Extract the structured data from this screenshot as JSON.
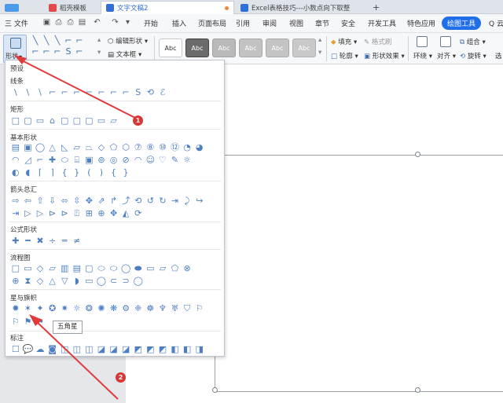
{
  "tabs": [
    {
      "label": "稻壳模板",
      "color": "#e34b4b"
    },
    {
      "label": "文字文稿2",
      "color": "#2f6fd6",
      "active": true
    },
    {
      "label": "Excel表格技巧---小数点向下取整",
      "color": "#2f6fd6"
    }
  ],
  "new_tab": "+",
  "menu": {
    "file": "三 文件",
    "items": [
      "开始",
      "插入",
      "页面布局",
      "引用",
      "审阅",
      "视图",
      "章节",
      "安全",
      "开发工具",
      "特色应用"
    ],
    "active_tool": "绘图工具",
    "search_fragment": "Q 云"
  },
  "ribbon": {
    "shape_label": "形状",
    "edit_shape": "编辑形状",
    "text_box": "文本框",
    "style_abc": [
      "Abc",
      "Abc",
      "Abc",
      "Abc",
      "Abc",
      "Abc"
    ],
    "fill": "填充",
    "format_brush": "格式刷",
    "outline": "轮廓",
    "shape_effects": "形状效果",
    "wrap": "环绕",
    "align": "对齐",
    "group": "组合",
    "rotate": "旋转",
    "select": "选"
  },
  "panel": {
    "preset": "预设",
    "sections": [
      {
        "title": "线条",
        "rows": [
          [
            "\\",
            "\\",
            "\\",
            "⌐",
            "⌐",
            "⌐",
            "⌐",
            "⌐",
            "⌐",
            "⌐",
            "S",
            "⟲",
            "ℰ"
          ]
        ]
      },
      {
        "title": "矩形",
        "rows": [
          [
            "□",
            "▢",
            "▭",
            "⌂",
            "▢",
            "▢",
            "▢",
            "▭",
            "▱"
          ]
        ]
      },
      {
        "title": "基本形状",
        "rows": [
          [
            "▤",
            "▣",
            "◯",
            "△",
            "◺",
            "▱",
            "⏢",
            "◇",
            "⬠",
            "⬡",
            "⑦",
            "⑧",
            "⑩",
            "⑫",
            "◔",
            "◕"
          ],
          [
            "◠",
            "◿",
            "⌐",
            "✚",
            "⬭",
            "⌸",
            "▣",
            "⊚",
            "◎",
            "⊘",
            "◠",
            "☺",
            "♡",
            "✎",
            "☼"
          ],
          [
            "◐",
            "◖",
            "⌈",
            "⌉",
            "{",
            "}",
            "(",
            ")",
            "{",
            "}"
          ]
        ]
      },
      {
        "title": "箭头总汇",
        "rows": [
          [
            "⇨",
            "⇦",
            "⇧",
            "⇩",
            "⬄",
            "⇳",
            "✥",
            "⇗",
            "↱",
            "⤴",
            "⟲",
            "↺",
            "↻",
            "⇥",
            "⤸",
            "↪"
          ],
          [
            "⇥",
            "▷",
            "▷",
            "⊳",
            "⊳",
            "⍐",
            "⊞",
            "⊕",
            "✥",
            "◭",
            "⟳"
          ]
        ]
      },
      {
        "title": "公式形状",
        "rows": [
          [
            "✚",
            "━",
            "✖",
            "÷",
            "═",
            "≠"
          ]
        ]
      },
      {
        "title": "流程图",
        "rows": [
          [
            "□",
            "▭",
            "◇",
            "▱",
            "▥",
            "▤",
            "▢",
            "⬭",
            "⬭",
            "◯",
            "⬬",
            "▭",
            "▱",
            "⬠",
            "⊗"
          ],
          [
            "⊕",
            "⧗",
            "◇",
            "△",
            "▽",
            "◗",
            "▭",
            "◯",
            "⊂",
            "⊃",
            "◯"
          ]
        ]
      },
      {
        "title": "星与旗帜",
        "rows": [
          [
            "✹",
            "✶",
            "✦",
            "✪",
            "✷",
            "☼",
            "❂",
            "✺",
            "❋",
            "⚙",
            "❈",
            "☸",
            "♆",
            "♅",
            "⛉",
            "⚐"
          ],
          [
            "⚐",
            "⚑",
            "⚑"
          ]
        ]
      },
      {
        "title": "标注",
        "rows": [
          [
            "☐",
            "💬",
            "☁",
            "◙",
            "◫",
            "◫",
            "◫",
            "◪",
            "◪",
            "◪",
            "◩",
            "◩",
            "◩",
            "◧",
            "◧",
            "◨"
          ]
        ]
      }
    ]
  },
  "tooltip": "五角星",
  "badges": [
    "1",
    "2"
  ],
  "colors": {
    "accent": "#1f6feb",
    "annotation_red": "#d93636",
    "shape_icon_blue": "#4f7fc3"
  }
}
